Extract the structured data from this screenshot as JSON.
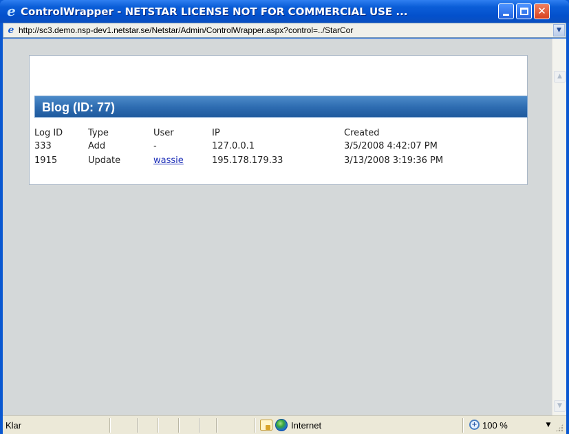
{
  "window": {
    "title": "ControlWrapper - NETSTAR LICENSE NOT FOR COMMERCIAL USE ...",
    "title_icon": "ie-logo-icon",
    "controls": {
      "minimize": "minimize",
      "maximize": "maximize",
      "close": "✕"
    }
  },
  "address": {
    "url": "http://sc3.demo.nsp-dev1.netstar.se/Netstar/Admin/ControlWrapper.aspx?control=../StarCor",
    "page_icon": "ie-page-icon"
  },
  "panel": {
    "title": "Blog (ID: 77)",
    "header_color": "#2d6bb0"
  },
  "table": {
    "columns": [
      "Log ID",
      "Type",
      "User",
      "IP",
      "Created"
    ],
    "rows": [
      {
        "log_id": "333",
        "type": "Add",
        "user": "-",
        "ip": "127.0.0.1",
        "created": "3/5/2008 4:42:07 PM"
      },
      {
        "log_id": "1915",
        "type": "Update",
        "user": "wassie",
        "ip": "195.178.179.33",
        "created": "3/13/2008 3:19:36 PM"
      }
    ]
  },
  "status": {
    "text": "Klar",
    "zone": "Internet",
    "zoom": "100 %"
  }
}
